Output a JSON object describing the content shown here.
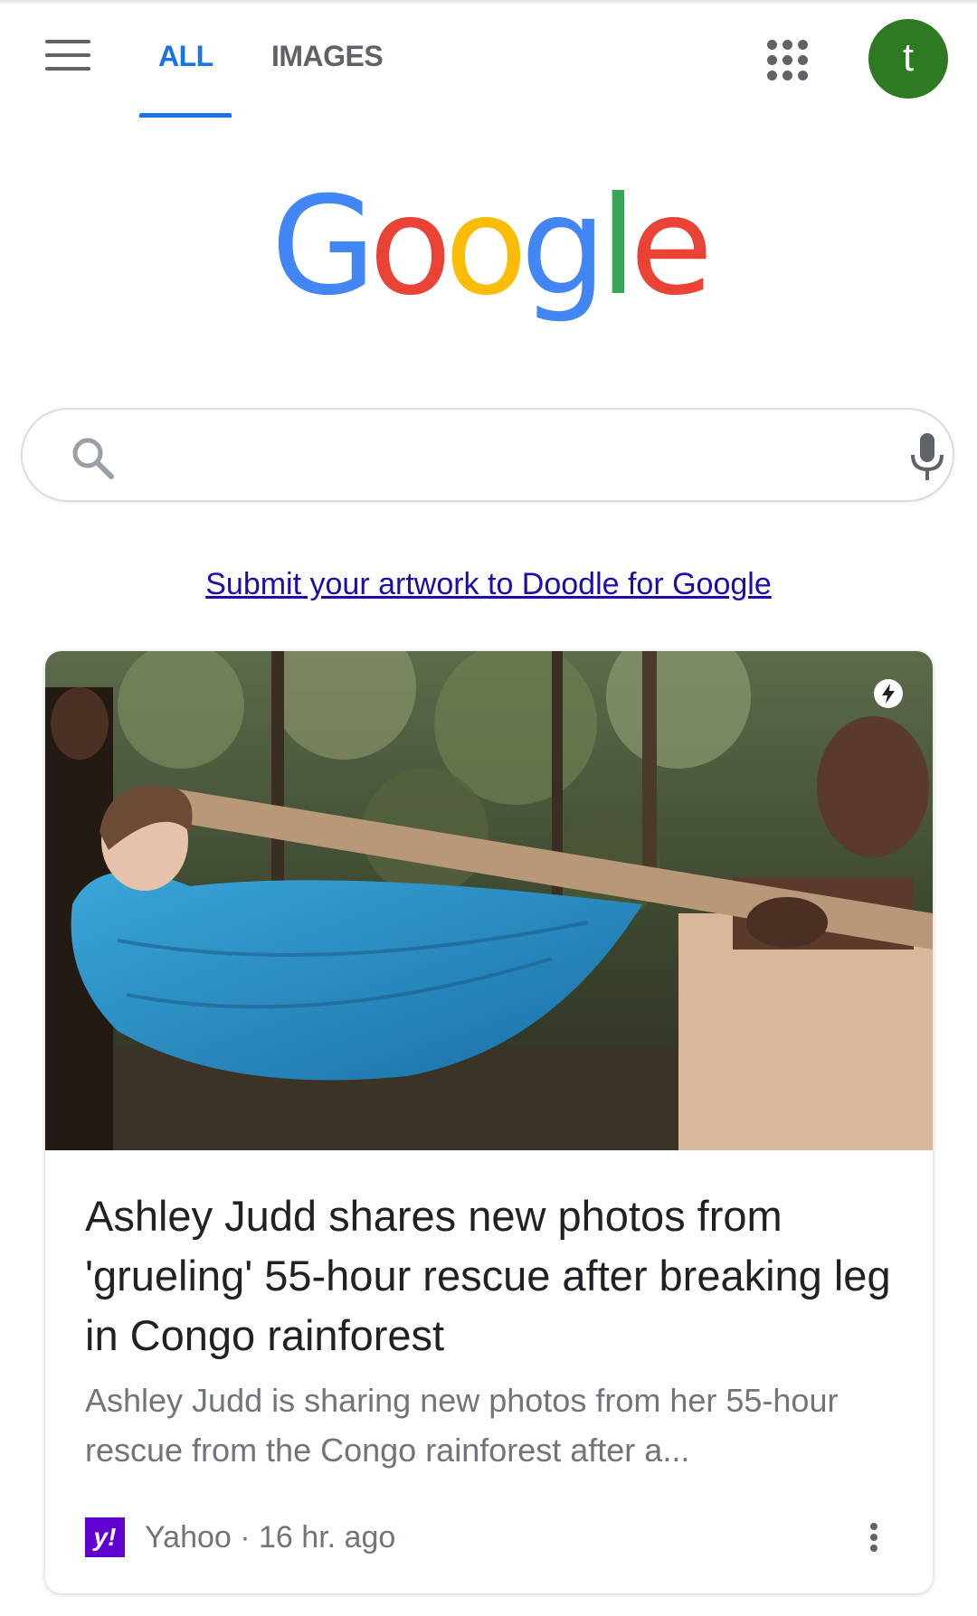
{
  "header": {
    "menu_icon": "hamburger-menu-icon",
    "tabs": [
      {
        "label": "ALL",
        "active": true
      },
      {
        "label": "IMAGES",
        "active": false
      }
    ],
    "apps_icon": "apps-grid-icon",
    "avatar_letter": "t",
    "avatar_color": "#2d7a23"
  },
  "logo": {
    "letters": [
      "G",
      "o",
      "o",
      "g",
      "l",
      "e"
    ],
    "colors": [
      "#4285f4",
      "#ea4335",
      "#fbbc05",
      "#4285f4",
      "#34a853",
      "#ea4335"
    ]
  },
  "search": {
    "value": "",
    "search_icon": "search-icon",
    "mic_icon": "microphone-icon"
  },
  "promo_link": "Submit your artwork to Doodle for Google",
  "news_card": {
    "amp_badge_icon": "amp-lightning-icon",
    "title": "Ashley Judd shares new photos from 'grueling' 55-hour rescue after breaking leg in Congo rainforest",
    "snippet": "Ashley Judd is sharing new photos from her 55-hour rescue from the Congo rainforest after a...",
    "source_logo_text": "y!",
    "source_logo_color": "#6001d2",
    "source": "Yahoo",
    "separator": " · ",
    "age": "16 hr. ago",
    "more_icon": "more-vert-icon"
  },
  "colors": {
    "accent_blue": "#1a73e8",
    "link": "#1a0dab",
    "text_primary": "#202124",
    "text_secondary": "#70757a"
  }
}
